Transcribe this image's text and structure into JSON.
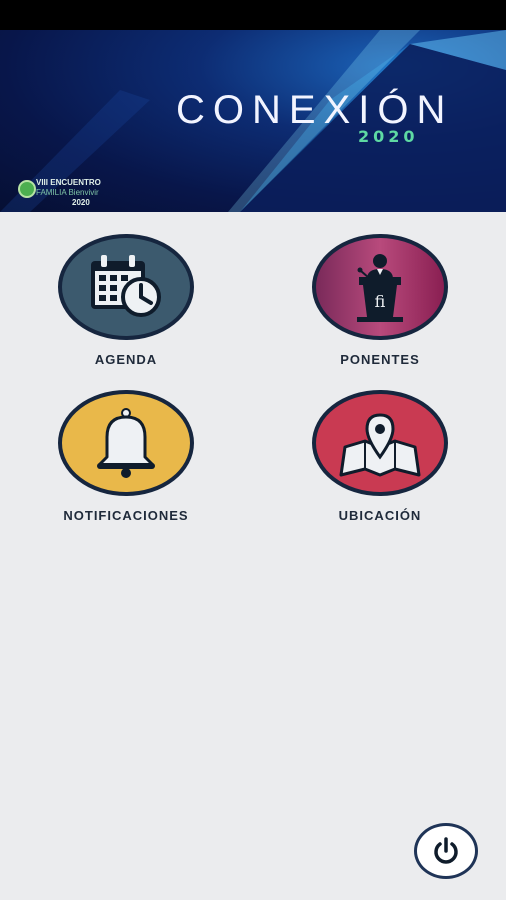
{
  "banner": {
    "title": "CONEXIÓN",
    "year": "2020",
    "event_line1": "VIII ENCUENTRO",
    "event_line2": "FAMILIA Bienvivir",
    "event_line3": "2020"
  },
  "menu": [
    {
      "label": "AGENDA",
      "icon": "calendar-clock-icon",
      "color": "#3c5a6e"
    },
    {
      "label": "PONENTES",
      "icon": "speaker-podium-icon",
      "color": "#9a2f63"
    },
    {
      "label": "NOTIFICACIONES",
      "icon": "bell-icon",
      "color": "#e9b84a"
    },
    {
      "label": "UBICACIÓN",
      "icon": "map-pin-icon",
      "color": "#c93a52"
    }
  ],
  "power_button": {
    "icon": "power-icon"
  }
}
